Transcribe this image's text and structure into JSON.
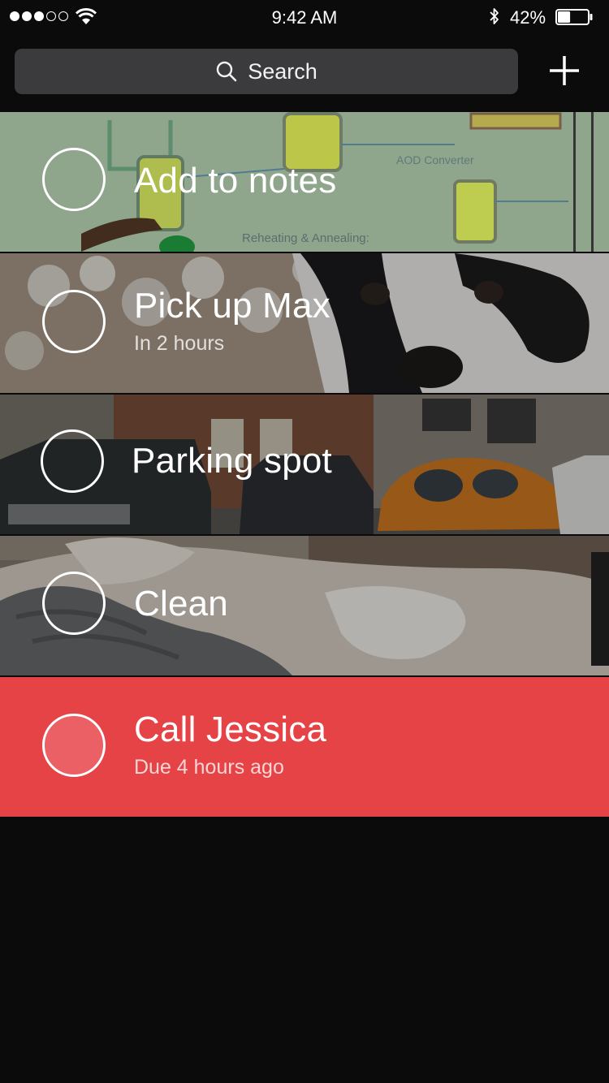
{
  "status_bar": {
    "time": "9:42 AM",
    "battery_percent": "42%",
    "battery_level": 0.42,
    "signal_bars_filled": 3,
    "signal_bars_total": 5
  },
  "header": {
    "search_label": "Search",
    "search_icon": "search-icon",
    "add_icon": "plus-icon"
  },
  "tasks": [
    {
      "title": "Add to notes",
      "subtitle": "",
      "background": "whiteboard-photo"
    },
    {
      "title": "Pick up Max",
      "subtitle": "In 2 hours",
      "background": "dog-photo"
    },
    {
      "title": "Parking spot",
      "subtitle": "",
      "background": "street-parking-photo"
    },
    {
      "title": "Clean",
      "subtitle": "",
      "background": "bed-photo"
    },
    {
      "title": "Call Jessica",
      "subtitle": "Due 4 hours ago",
      "background": "overdue-red",
      "color": "#e64346"
    }
  ],
  "photo_text": {
    "whiteboard_converter": "AOD Converter",
    "whiteboard_reheating": "Reheating & Annealing:"
  }
}
